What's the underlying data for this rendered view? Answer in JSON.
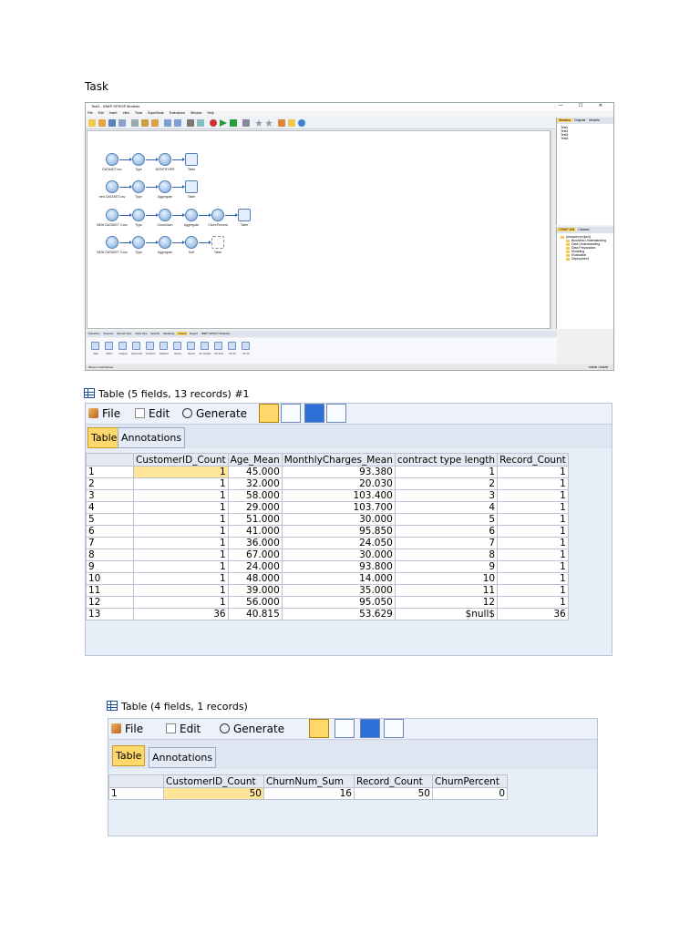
{
  "task_label": "Task",
  "modeler": {
    "title": "Test1 - IBM® SPSS® Modeler",
    "window_controls": "— ☐ ✕",
    "menu": [
      "File",
      "Edit",
      "Insert",
      "View",
      "Tools",
      "SuperNode",
      "Extensions",
      "Window",
      "Help"
    ],
    "streams": [
      {
        "nodes": [
          "DATASET.csv",
          "Type",
          "MONTHYIER",
          "Table"
        ]
      },
      {
        "nodes": [
          "new DATASET.csv",
          "Type",
          "Aggregate",
          "Table"
        ]
      },
      {
        "nodes": [
          "NEW DATASET 2.csv",
          "Type",
          "ChurnNum",
          "Aggregate",
          "ChurnPercent",
          "Table"
        ]
      },
      {
        "nodes": [
          "NEW DATASET 2.csv",
          "Type",
          "Aggregate",
          "Sort",
          "Table"
        ]
      }
    ],
    "right_top_tabs": [
      "Streams",
      "Outputs",
      "Models"
    ],
    "right_top_items": [
      "Test1",
      "Test2",
      "Test3",
      "Test4"
    ],
    "right_bottom_tabs": [
      "CRISP-DM",
      "Classes"
    ],
    "right_bottom_items": [
      "(unsaved project)",
      "Business Understanding",
      "Data Understanding",
      "Data Preparation",
      "Modeling",
      "Evaluation",
      "Deployment"
    ],
    "palette_tabs": [
      "Favorites",
      "Sources",
      "Record Ops",
      "Field Ops",
      "Graphs",
      "Modeling",
      "Output",
      "Export",
      "IBM® SPSS® Statistics"
    ],
    "palette_active": "Output",
    "palette_items": [
      "Table",
      "Matrix",
      "Analysis",
      "Data Audit",
      "Transform",
      "Statistics",
      "Means",
      "Report",
      "Set Globals",
      "Sim Eval",
      "Sim Fit",
      "Sim Fit"
    ],
    "status": "Server: Local Server",
    "status_right": "158MB / 366MB"
  },
  "table1": {
    "title": "Table (5 fields, 13 records) #1",
    "menu": {
      "file": "File",
      "edit": "Edit",
      "generate": "Generate"
    },
    "tabs": [
      "Table",
      "Annotations"
    ],
    "columns": [
      "",
      "CustomerID_Count",
      "Age_Mean",
      "MonthlyCharges_Mean",
      "contract type length",
      "Record_Count"
    ],
    "rows": [
      [
        "1",
        "1",
        "45.000",
        "93.380",
        "1",
        "1"
      ],
      [
        "2",
        "1",
        "32.000",
        "20.030",
        "2",
        "1"
      ],
      [
        "3",
        "1",
        "58.000",
        "103.400",
        "3",
        "1"
      ],
      [
        "4",
        "1",
        "29.000",
        "103.700",
        "4",
        "1"
      ],
      [
        "5",
        "1",
        "51.000",
        "30.000",
        "5",
        "1"
      ],
      [
        "6",
        "1",
        "41.000",
        "95.850",
        "6",
        "1"
      ],
      [
        "7",
        "1",
        "36.000",
        "24.050",
        "7",
        "1"
      ],
      [
        "8",
        "1",
        "67.000",
        "30.000",
        "8",
        "1"
      ],
      [
        "9",
        "1",
        "24.000",
        "93.800",
        "9",
        "1"
      ],
      [
        "10",
        "1",
        "48.000",
        "14.000",
        "10",
        "1"
      ],
      [
        "11",
        "1",
        "39.000",
        "35.000",
        "11",
        "1"
      ],
      [
        "12",
        "1",
        "56.000",
        "95.050",
        "12",
        "1"
      ],
      [
        "13",
        "36",
        "40.815",
        "53.629",
        "$null$",
        "36"
      ]
    ]
  },
  "table2": {
    "title": "Table (4 fields, 1 records)",
    "menu": {
      "file": "File",
      "edit": "Edit",
      "generate": "Generate"
    },
    "tabs": [
      "Table",
      "Annotations"
    ],
    "columns": [
      "",
      "CustomerID_Count",
      "ChurnNum_Sum",
      "Record_Count",
      "ChurnPercent"
    ],
    "rows": [
      [
        "1",
        "50",
        "16",
        "50",
        "0"
      ]
    ]
  }
}
